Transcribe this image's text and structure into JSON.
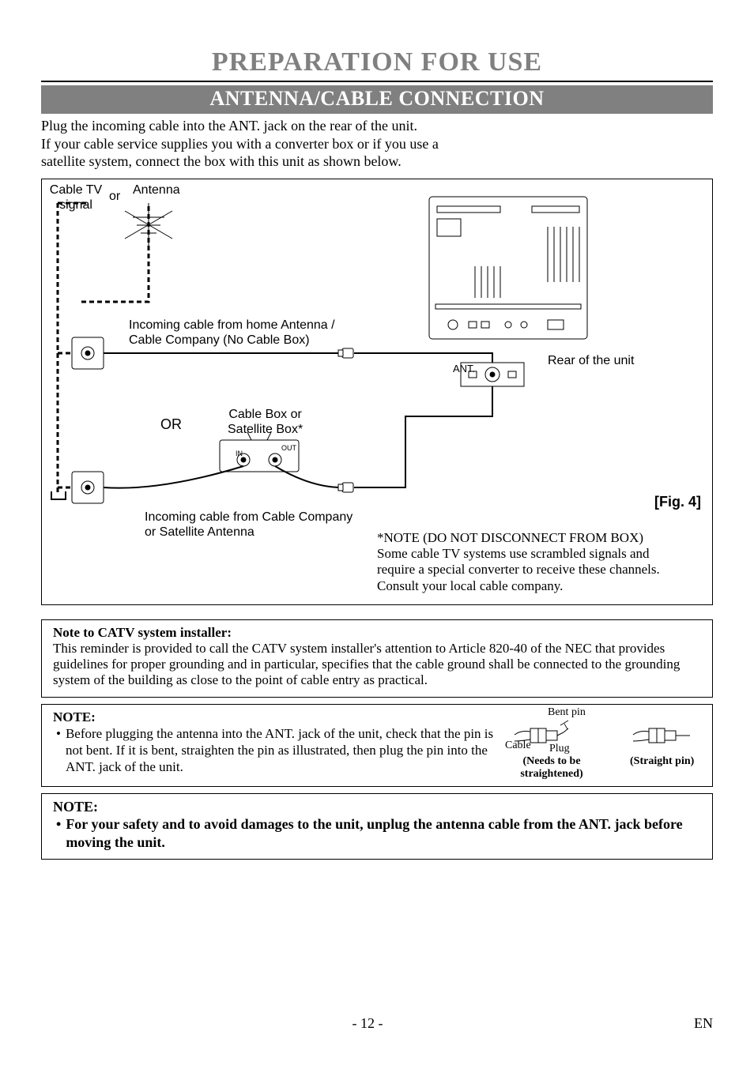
{
  "title": "PREPARATION FOR USE",
  "section": "ANTENNA/CABLE CONNECTION",
  "intro": "Plug the incoming cable into the ANT. jack on the rear of the unit.\nIf your cable service supplies you with a converter box or if you use a\nsatellite system, connect the box with this unit as shown below.",
  "figure": {
    "cable_tv_signal": "Cable\nTV signal",
    "or_lbl": "or",
    "antenna": "Antenna",
    "incoming_no_box": "Incoming cable from home Antenna /\nCable Company (No Cable Box)",
    "or_big": "OR",
    "cablebox": "Cable Box or\nSatellite Box*",
    "in": "IN",
    "out": "OUT",
    "incoming_company": "Incoming cable from Cable Company\nor Satellite Antenna",
    "rear": "Rear of the unit",
    "ant": "ANT.",
    "caption": "[Fig. 4]",
    "note_star": "*NOTE (DO NOT DISCONNECT FROM BOX)\nSome cable TV systems use scrambled signals and\nrequire a special converter to receive these channels.\nConsult your local cable company."
  },
  "catv_note": {
    "heading": "Note to CATV system installer:",
    "body": "This reminder is provided to call the CATV system installer's attention to Article 820-40 of the NEC that provides guidelines for proper grounding and in particular, specifies that the cable ground shall be connected to the grounding system of the building as close to the point of cable entry as practical."
  },
  "pin_note": {
    "heading": "NOTE:",
    "bullet": "Before plugging the antenna into the ANT. jack of the unit, check that the pin is not bent. If it is bent, straighten the pin as illustrated, then plug the pin into the ANT. jack of the unit.",
    "bent_pin": "Bent pin",
    "cable": "Cable",
    "plug": "Plug",
    "needs": "(Needs to be\nstraightened)",
    "straight": "(Straight pin)"
  },
  "safety_note": {
    "heading": "NOTE:",
    "bullet": "For your safety and to avoid damages to the unit, unplug the antenna cable from the ANT. jack before moving the unit."
  },
  "footer": {
    "page": "- 12 -",
    "lang": "EN"
  }
}
